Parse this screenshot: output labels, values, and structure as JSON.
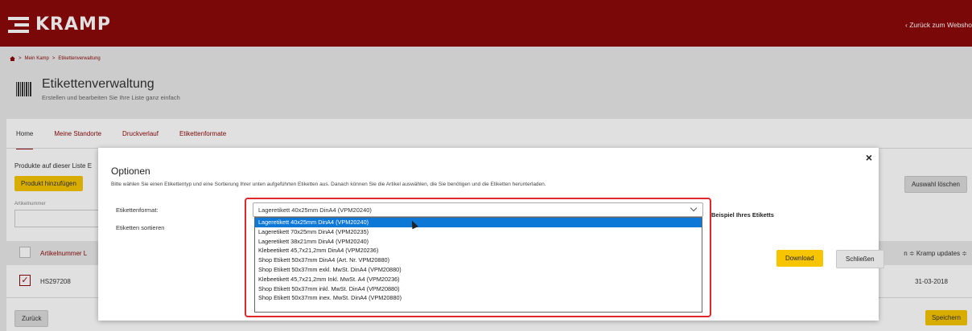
{
  "header": {
    "brand": "KRAMP",
    "back_link": "‹ Zurück zum Websho"
  },
  "breadcrumb": {
    "items": [
      "Mein Kamp",
      "Etikettenverwaltung"
    ],
    "separator": ">"
  },
  "page": {
    "title": "Etikettenverwaltung",
    "subtitle": "Erstellen und bearbeiten Sie Ihre Liste ganz einfach"
  },
  "tabs": [
    {
      "label": "Home"
    },
    {
      "label": "Meine Standorte"
    },
    {
      "label": "Druckverlauf"
    },
    {
      "label": "Etikettenformate"
    }
  ],
  "list": {
    "label": "Produkte auf dieser Liste E",
    "add_button": "Produkt hinzufügen",
    "clear_button": "Auswahl löschen",
    "article_label": "Artikelnummer"
  },
  "table": {
    "col_article": "Artikelnummer  L",
    "col_right": "n ≑  Kramp updates ≑",
    "row": {
      "article": "HS297208",
      "date": "31-03-2018"
    }
  },
  "footer": {
    "back_button": "Zurück",
    "save_button": "Speichern"
  },
  "modal": {
    "title": "Optionen",
    "description": "Bitte wählen Sie einen Etikettentyp und eine Sortierung Ihrer unten aufgeführten Etiketten aus. Danach können Sie die Artikel auswählen, die Sie benötigen und die Etiketten herunterladen.",
    "format_label": "Etikettenformat:",
    "sort_label": "Etiketten sortieren",
    "selected_value": "Lageretikett 40x25mm DinA4 (VPM20240)",
    "options": [
      "Lageretikett 40x25mm DinA4 (VPM20240)",
      "Lageretikett 70x25mm DinA4 (VPM20235)",
      "Lageretikett 38x21mm DinA4 (VPM20240)",
      "Klebeetikett 45,7x21,2mm DinA4 (VPM20236)",
      "Shop Etikett 50x37mm DinA4 (Art. Nr. VPM20880)",
      "Shop Etikett 50x37mm exkl. MwSt. DinA4 (VPM20880)",
      "Klebeetikett 45,7x21,2mm Inkl. MwSt. A4 (VPM20236)",
      "Shop Etikett 50x37mm inkl. MwSt. DinA4 (VPM20880)",
      "Shop Etikett 50x37mm inex. MwSt. DinA4 (VPM20880)"
    ],
    "example_label": "Beispiel Ihres Etiketts",
    "download_button": "Download",
    "close_button": "Schließen",
    "close_icon": "×"
  },
  "colors": {
    "brand": "#8b0a0a",
    "accent_yellow": "#f6c500",
    "highlight": "#e0272b",
    "selection": "#0e78d6"
  }
}
